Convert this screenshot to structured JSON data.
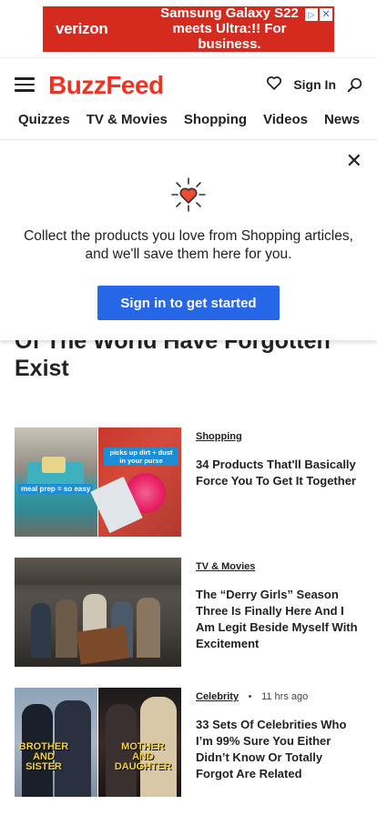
{
  "ad": {
    "brand": "verizon",
    "copy_line1": "Samsung Galaxy S22",
    "copy_line2": "meets Ultra:!! For business.",
    "close": "✕",
    "info": "▷"
  },
  "header": {
    "logo": "BuzzFeed",
    "signin": "Sign In"
  },
  "nav": [
    "Quizzes",
    "TV & Movies",
    "Shopping",
    "Videos",
    "News"
  ],
  "save_panel": {
    "text": "Collect the products you love from Shopping articles, and we'll save them here for you.",
    "cta": "Sign in to get started",
    "close": "✕"
  },
  "headline": {
    "line1": "Of The World Have Forgotten",
    "line2": "Exist"
  },
  "articles": [
    {
      "category": "Shopping",
      "time": "",
      "title": "34 Products That'll Basically Force You To Get It Together",
      "thumb_left_caption": "meal prep = so easy",
      "thumb_right_caption": "picks up dirt + dust in your purse"
    },
    {
      "category": "TV & Movies",
      "time": "",
      "title": "The “Derry Girls” Season Three Is Finally Here And I Am Legit Beside Myself With Excitement"
    },
    {
      "category": "Celebrity",
      "time": "11 hrs ago",
      "title": "33 Sets Of Celebrities Who I’m 99% Sure You Either Didn’t Know Or Totally Forgot Are Related",
      "thumb_left_caption": "BROTHER AND SISTER",
      "thumb_right_caption": "MOTHER AND DAUGHTER"
    }
  ]
}
